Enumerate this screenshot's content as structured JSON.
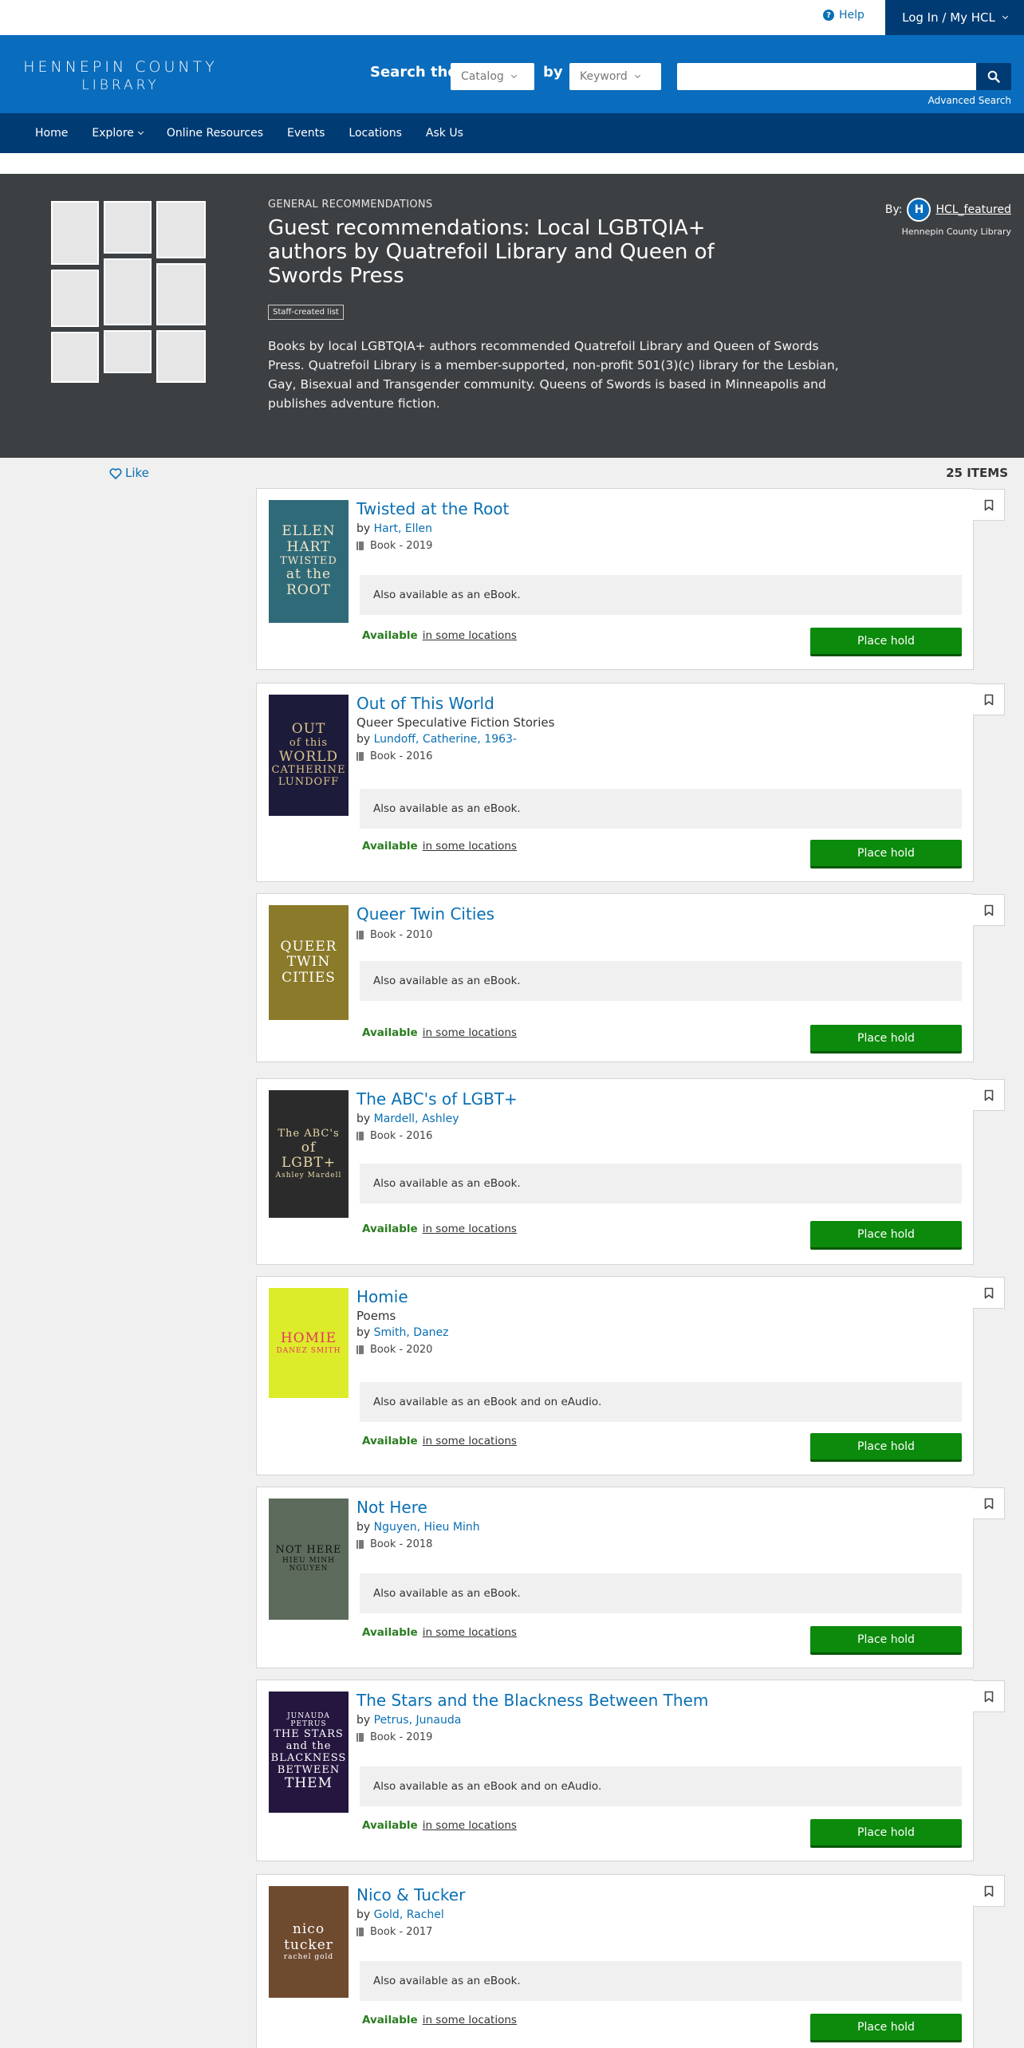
{
  "utility": {
    "help": "Help",
    "login": "Log In / My HCL"
  },
  "header": {
    "logo_line1": "HENNEPIN COUNTY",
    "logo_line2": "LIBRARY",
    "search_label": "Search the",
    "catalog_value": "Catalog",
    "by_label": "by",
    "keyword_value": "Keyword",
    "search_placeholder": "",
    "advanced": "Advanced Search"
  },
  "nav": {
    "items": [
      "Home",
      "Explore",
      "Online Resources",
      "Events",
      "Locations",
      "Ask Us"
    ]
  },
  "hero": {
    "kicker": "GENERAL RECOMMENDATIONS",
    "title": "Guest recommendations: Local LGBTQIA+ authors by Quatrefoil Library and Queen of Swords Press",
    "badge": "Staff-created list",
    "description": "Books by local LGBTQIA+ authors recommended Quatrefoil Library and Queen of Swords Press. Quatrefoil Library is a member-supported, non-profit 501(3)(c) library for the Lesbian, Gay, Bisexual and Transgender community. Queens of Swords is based in Minneapolis and publishes adventure fiction.",
    "by_label": "By:",
    "avatar_letter": "H",
    "by_name": "HCL_featured",
    "by_org": "Hennepin County Library"
  },
  "list": {
    "like": "Like",
    "count": "25 ITEMS"
  },
  "common": {
    "available": "Available",
    "locations": "in some locations",
    "place_hold": "Place hold",
    "by": "by"
  },
  "books": [
    {
      "title": "Twisted at the Root",
      "subtitle": "",
      "author": "Hart, Ellen",
      "format": "Book - 2019",
      "also": "Also available as an eBook.",
      "cover_text": [
        "ELLEN",
        "HART",
        "TWISTED",
        "at the",
        "ROOT"
      ],
      "cover_bg": "#2f6a78",
      "cover_fg": "#f2e6c9"
    },
    {
      "title": "Out of This World",
      "subtitle": "Queer Speculative Fiction Stories",
      "author": "Lundoff, Catherine, 1963-",
      "format": "Book - 2016",
      "also": "Also available as an eBook.",
      "cover_text": [
        "OUT",
        "of this",
        "WORLD",
        "CATHERINE",
        "LUNDOFF"
      ],
      "cover_bg": "#1d1b3a",
      "cover_fg": "#d9c38a"
    },
    {
      "title": "Queer Twin Cities",
      "subtitle": "",
      "author": "",
      "format": "Book - 2010",
      "also": "Also available as an eBook.",
      "cover_text": [
        "QUEER",
        "TWIN",
        "CITIES"
      ],
      "cover_bg": "#8a7a2a",
      "cover_fg": "#ffffff"
    },
    {
      "title": "The ABC's of LGBT+",
      "subtitle": "",
      "author": "Mardell, Ashley",
      "format": "Book - 2016",
      "also": "Also available as an eBook.",
      "cover_text": [
        "The ABC's",
        "of",
        "LGBT+",
        "Ashley Mardell"
      ],
      "cover_bg": "#2b2b2b",
      "cover_fg": "#e8d8a8"
    },
    {
      "title": "Homie",
      "subtitle": "Poems",
      "author": "Smith, Danez",
      "format": "Book - 2020",
      "also": "Also available as an eBook and on eAudio.",
      "cover_text": [
        "HOMIE",
        "DANEZ SMITH"
      ],
      "cover_bg": "#dcec2a",
      "cover_fg": "#e8365f"
    },
    {
      "title": "Not Here",
      "subtitle": "",
      "author": "Nguyen, Hieu Minh",
      "format": "Book - 2018",
      "also": "Also available as an eBook.",
      "cover_text": [
        "NOT HERE",
        "HIEU MINH NGUYEN"
      ],
      "cover_bg": "#5d6b5c",
      "cover_fg": "#111111"
    },
    {
      "title": "The Stars and the Blackness Between Them",
      "subtitle": "",
      "author": "Petrus, Junauda",
      "format": "Book - 2019",
      "also": "Also available as an eBook and on eAudio.",
      "cover_text": [
        "JUNAUDA PETRUS",
        "THE STARS",
        "and the",
        "BLACKNESS",
        "BETWEEN",
        "THEM"
      ],
      "cover_bg": "#24163f",
      "cover_fg": "#ffffff"
    },
    {
      "title": "Nico & Tucker",
      "subtitle": "",
      "author": "Gold, Rachel",
      "format": "Book - 2017",
      "also": "Also available as an eBook.",
      "cover_text": [
        "nico",
        "tucker",
        "rachel gold"
      ],
      "cover_bg": "#6e4a2f",
      "cover_fg": "#ffffff"
    }
  ],
  "colors": {
    "brand_blue": "#0a6cbc",
    "dark_navy": "#003b73",
    "hold_green": "#0b8a0b",
    "hero_bg": "#3d4043"
  }
}
